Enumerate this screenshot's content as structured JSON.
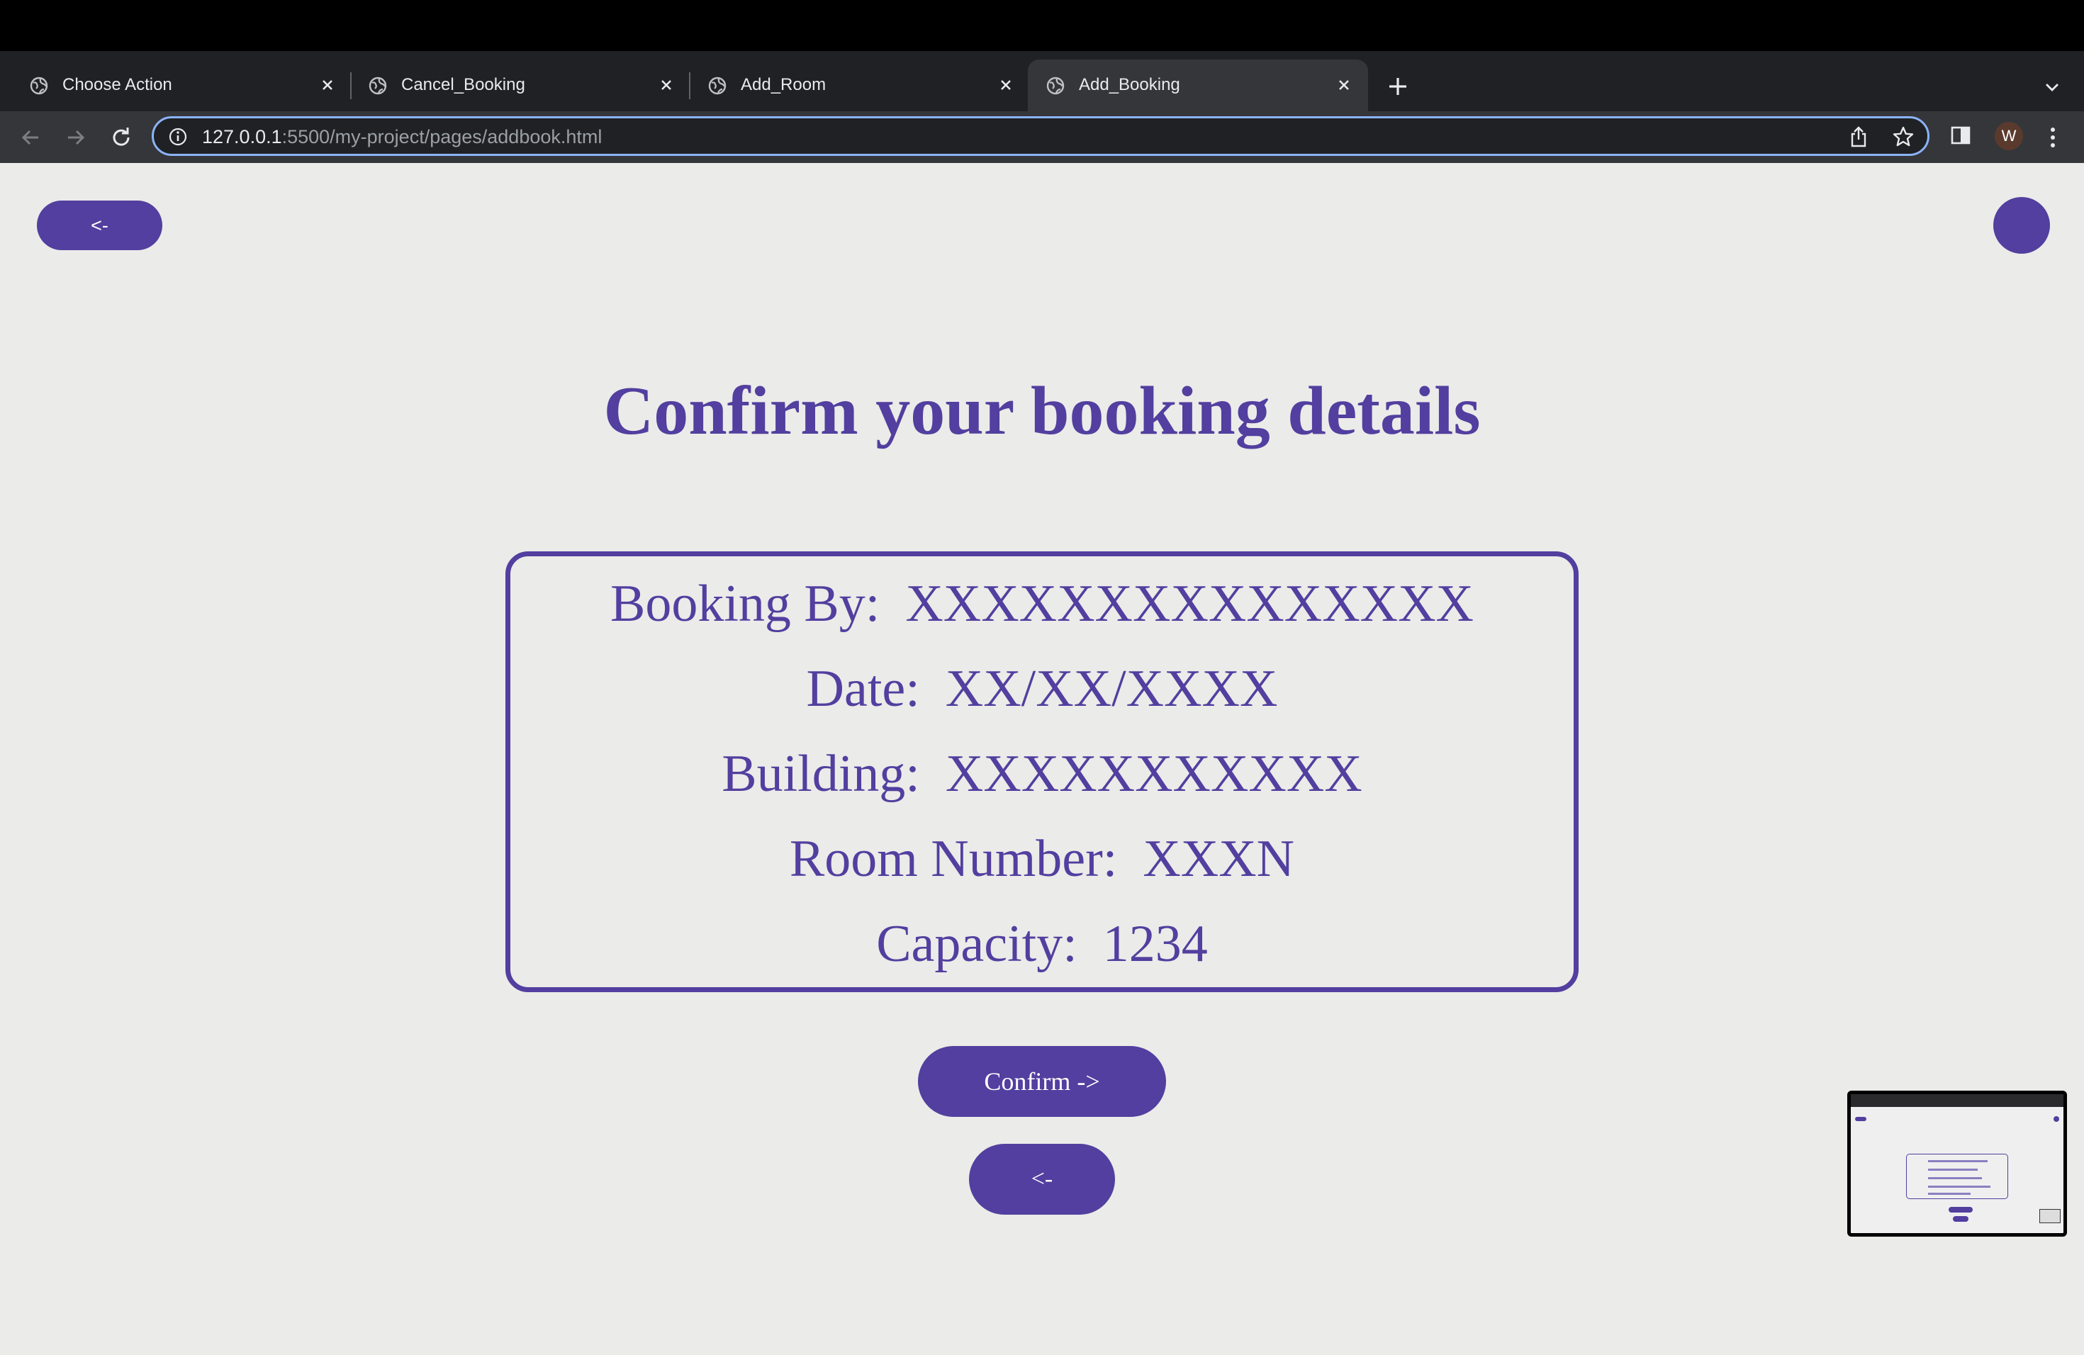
{
  "browser": {
    "tabs": [
      {
        "label": "Choose Action",
        "active": false
      },
      {
        "label": "Cancel_Booking",
        "active": false
      },
      {
        "label": "Add_Room",
        "active": false
      },
      {
        "label": "Add_Booking",
        "active": true
      }
    ],
    "url_host": "127.0.0.1",
    "url_rest": ":5500/my-project/pages/addbook.html",
    "profile_initial": "W"
  },
  "page": {
    "back_top_label": "<-",
    "title": "Confirm your booking details",
    "details": [
      {
        "label": "Booking By:",
        "value": "XXXXXXXXXXXXXXX"
      },
      {
        "label": "Date:",
        "value": "XX/XX/XXXX"
      },
      {
        "label": "Building:",
        "value": "XXXXXXXXXXX"
      },
      {
        "label": "Room Number:",
        "value": "XXXN"
      },
      {
        "label": "Capacity:",
        "value": "1234"
      }
    ],
    "confirm_label": "Confirm ->",
    "back_bottom_label": "<-"
  },
  "colors": {
    "accent": "#523f9f",
    "page_background": "#ebebe9",
    "tabstrip": "#202124",
    "toolbar": "#35363a",
    "focus_ring": "#8ab4f8"
  },
  "icons": {
    "tab_favicon": "globe-icon",
    "tab_close": "close-icon",
    "new_tab": "plus-icon",
    "tab_list": "chevron-down-icon",
    "back": "arrow-left-icon",
    "forward": "arrow-right-icon",
    "reload": "reload-icon",
    "site_info": "info-icon",
    "share": "share-icon",
    "bookmark": "star-icon",
    "side_panel": "side-panel-icon",
    "menu": "kebab-menu-icon"
  }
}
